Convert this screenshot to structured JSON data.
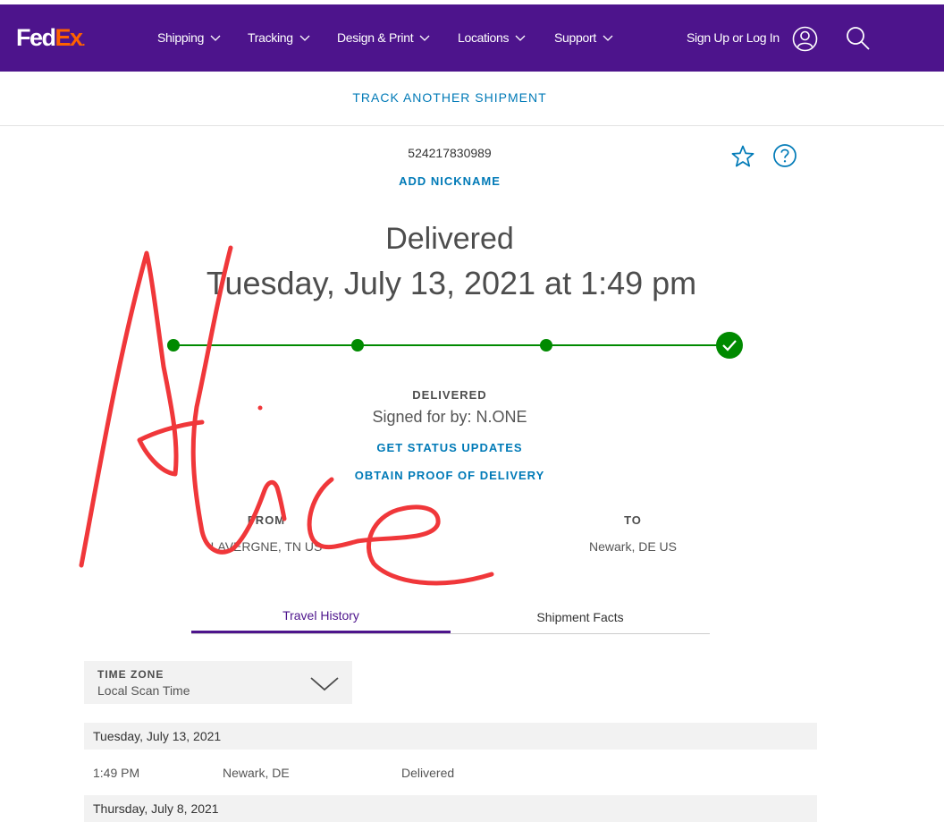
{
  "header": {
    "logo": {
      "fed": "Fed",
      "ex": "Ex",
      "dot": "."
    },
    "nav": [
      {
        "label": "Shipping"
      },
      {
        "label": "Tracking"
      },
      {
        "label": "Design & Print"
      },
      {
        "label": "Locations"
      },
      {
        "label": "Support"
      }
    ],
    "signin": "Sign Up or Log In",
    "icons": {
      "account": "account-icon",
      "search": "search-icon"
    },
    "colors": {
      "brand_purple": "#4d148c",
      "brand_orange": "#ff6200"
    }
  },
  "track_another": "TRACK ANOTHER SHIPMENT",
  "shipment": {
    "tracking_number": "524217830989",
    "add_nickname": "ADD NICKNAME",
    "status": "Delivered",
    "delivery_date": "Tuesday, July 13, 2021 at 1:49 pm",
    "progress": {
      "steps_total": 4,
      "steps_completed": 4,
      "color": "#008a00"
    },
    "status_label": "DELIVERED",
    "signed_for": "Signed for by: N.ONE",
    "get_updates": "GET STATUS UPDATES",
    "proof": "OBTAIN PROOF OF DELIVERY",
    "from_label": "FROM",
    "from_value": "LAVERGNE, TN US",
    "to_label": "TO",
    "to_value": "Newark, DE US"
  },
  "tabs": [
    {
      "label": "Travel History",
      "active": true
    },
    {
      "label": "Shipment Facts",
      "active": false
    }
  ],
  "timezone": {
    "label": "TIME ZONE",
    "value": "Local Scan Time"
  },
  "history": {
    "days": [
      {
        "date": "Tuesday, July 13, 2021"
      },
      {
        "date": "Thursday, July 8, 2021"
      }
    ],
    "events": [
      {
        "time": "1:49 PM",
        "location": "Newark, DE",
        "status": "Delivered"
      }
    ]
  },
  "annotation": {
    "color": "#f0373a"
  }
}
